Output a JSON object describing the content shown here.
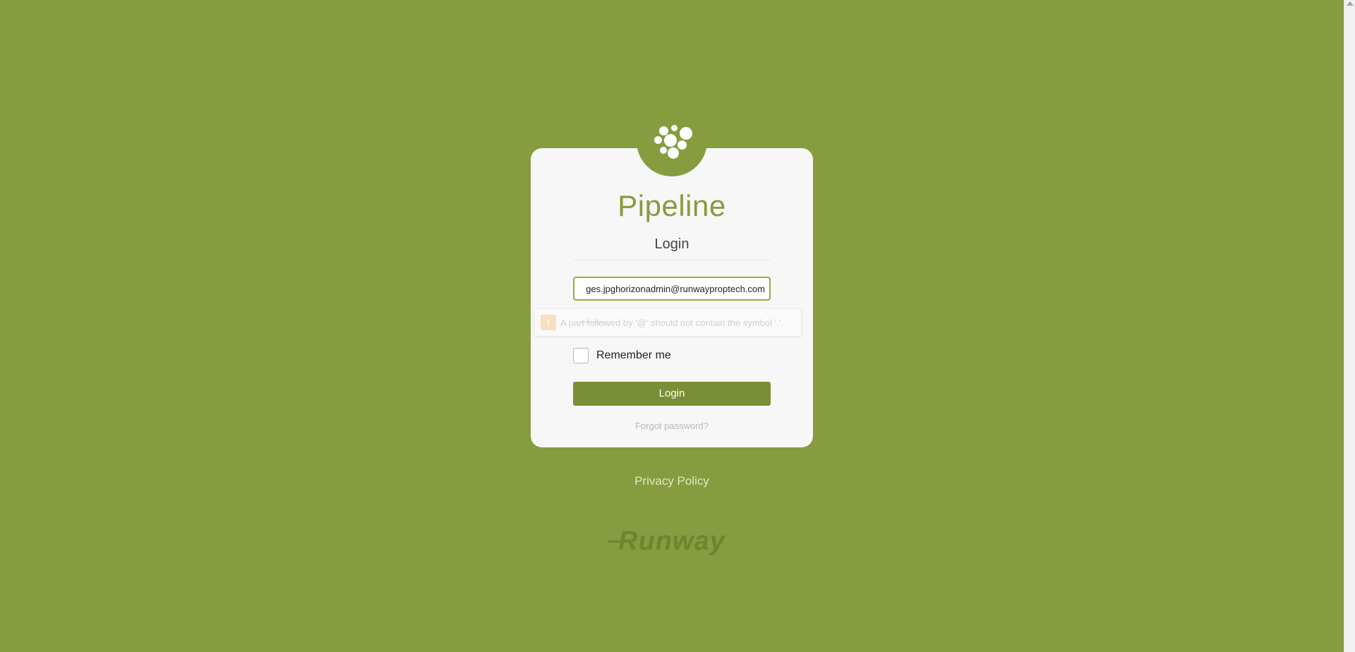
{
  "app": {
    "brand": "Pipeline",
    "subtitle": "Login"
  },
  "form": {
    "email_value": "ges.jpghorizonadmin@runwayproptech.com",
    "password_mask": "•••••••••••",
    "validation_message": "A part followed by '@' should not contain the symbol '.'.",
    "remember_label": "Remember me",
    "login_label": "Login",
    "forgot_label": "Forgot password?"
  },
  "footer": {
    "privacy_label": "Privacy Policy",
    "company_logo": "Runway"
  },
  "colors": {
    "background": "#879c3e",
    "brand": "#879c3e",
    "button": "#7a8f35",
    "card": "#f7f7f7"
  },
  "icons": {
    "logo": "bubbles-logo-icon",
    "warning": "warning-icon"
  }
}
